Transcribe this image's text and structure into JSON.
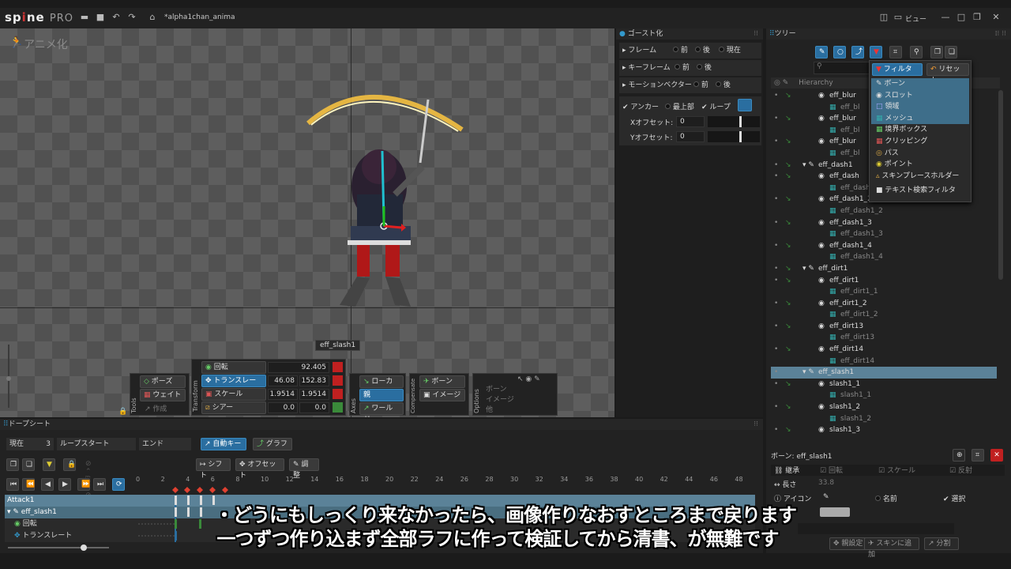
{
  "title_bar": {
    "logo": "sp",
    "logo_mid": "ne",
    "logo_pro": "PRO",
    "project": "*alpha1chan_anima",
    "view_menu": "ビュー"
  },
  "viewport": {
    "mode_label": "アニメ化",
    "bone_tooltip": "eff_slash1"
  },
  "tools": {
    "section": "Tools",
    "pose": "ポーズ",
    "weight": "ウェイト",
    "create": "作成"
  },
  "transform": {
    "section": "Transform",
    "rotate": {
      "label": "回転",
      "value": "92.405"
    },
    "translate": {
      "label": "トランスレート",
      "x": "46.08",
      "y": "152.83"
    },
    "scale": {
      "label": "スケール",
      "x": "1.9514",
      "y": "1.9514"
    },
    "shear": {
      "label": "シアー",
      "x": "0.0",
      "y": "0.0"
    }
  },
  "axes": {
    "section": "Axes",
    "local": "ローカル",
    "parent": "親",
    "world": "ワールド"
  },
  "compensate": {
    "section": "Compensate",
    "bone": "ボーン",
    "image": "イメージ"
  },
  "options": {
    "section": "Options",
    "bone": "ボーン",
    "image": "イメージ",
    "other": "他"
  },
  "ghosting": {
    "title": "ゴースト化",
    "frames": "フレーム",
    "keyframes": "キーフレーム",
    "motion": "モーションベクター",
    "prev": "前",
    "next": "後",
    "current": "現在",
    "anchor": "アンカー",
    "top": "最上部",
    "loop": "ループ",
    "x_offset": "Xオフセット:",
    "y_offset": "Yオフセット:",
    "x_value": "0",
    "y_value": "0"
  },
  "dopesheet": {
    "title": "ドープシート",
    "current": "現在",
    "current_value": "3",
    "loop_start": "ループスタート",
    "end": "エンド",
    "auto_key": "自動キー",
    "graph": "グラフ",
    "shift": "シフト",
    "offset": "オフセット",
    "adjust": "調整",
    "ticks": [
      "0",
      "2",
      "4",
      "6",
      "8",
      "10",
      "12",
      "14",
      "16",
      "18",
      "20",
      "22",
      "24",
      "26",
      "28",
      "30",
      "32",
      "34",
      "36",
      "38",
      "40",
      "42",
      "44",
      "46",
      "48"
    ],
    "rows": [
      {
        "label": "Attack1"
      },
      {
        "label": "eff_slash1"
      },
      {
        "label": "回転"
      },
      {
        "label": "トランスレート"
      }
    ]
  },
  "tree": {
    "title": "ツリー",
    "hierarchy": "Hierarchy",
    "filter": "フィルター",
    "reset": "リセット",
    "items": [
      {
        "name": "eff_blur",
        "type": "slot",
        "eye": true,
        "key": true
      },
      {
        "name": "eff_bl",
        "type": "attachment",
        "eye": false,
        "key": false
      },
      {
        "name": "eff_blur",
        "type": "slot",
        "eye": true,
        "key": true
      },
      {
        "name": "eff_bl",
        "type": "attachment",
        "eye": false,
        "key": false
      },
      {
        "name": "eff_blur",
        "type": "slot",
        "eye": true,
        "key": true
      },
      {
        "name": "eff_bl",
        "type": "attachment",
        "eye": false,
        "key": false
      },
      {
        "name": "eff_dash1",
        "type": "bone",
        "eye": true,
        "key": true
      },
      {
        "name": "eff_dash",
        "type": "slot",
        "eye": true,
        "key": true
      },
      {
        "name": "eff_dash",
        "type": "attachment",
        "eye": false,
        "key": false
      },
      {
        "name": "eff_dash1_2",
        "type": "slot",
        "eye": true,
        "key": true
      },
      {
        "name": "eff_dash1_2",
        "type": "attachment",
        "eye": false,
        "key": false
      },
      {
        "name": "eff_dash1_3",
        "type": "slot",
        "eye": true,
        "key": true
      },
      {
        "name": "eff_dash1_3",
        "type": "attachment",
        "eye": false,
        "key": false
      },
      {
        "name": "eff_dash1_4",
        "type": "slot",
        "eye": true,
        "key": true
      },
      {
        "name": "eff_dash1_4",
        "type": "attachment",
        "eye": false,
        "key": false
      },
      {
        "name": "eff_dirt1",
        "type": "bone",
        "eye": true,
        "key": true
      },
      {
        "name": "eff_dirt1",
        "type": "slot",
        "eye": true,
        "key": true
      },
      {
        "name": "eff_dirt1_1",
        "type": "attachment",
        "eye": false,
        "key": false
      },
      {
        "name": "eff_dirt1_2",
        "type": "slot",
        "eye": true,
        "key": true
      },
      {
        "name": "eff_dirt1_2",
        "type": "attachment",
        "eye": false,
        "key": false
      },
      {
        "name": "eff_dirt13",
        "type": "slot",
        "eye": true,
        "key": true
      },
      {
        "name": "eff_dirt13",
        "type": "attachment",
        "eye": false,
        "key": false
      },
      {
        "name": "eff_dirt14",
        "type": "slot",
        "eye": true,
        "key": true
      },
      {
        "name": "eff_dirt14",
        "type": "attachment",
        "eye": false,
        "key": false
      },
      {
        "name": "eff_slash1",
        "type": "bone",
        "eye": true,
        "key": false,
        "selected": true
      },
      {
        "name": "slash1_1",
        "type": "slot",
        "eye": true,
        "key": true
      },
      {
        "name": "slash1_1",
        "type": "attachment",
        "eye": false,
        "key": false
      },
      {
        "name": "slash1_2",
        "type": "slot",
        "eye": true,
        "key": true
      },
      {
        "name": "slash1_2",
        "type": "attachment",
        "eye": false,
        "key": false
      },
      {
        "name": "slash1_3",
        "type": "slot",
        "eye": true,
        "key": true
      }
    ],
    "filter_menu": [
      "ボーン",
      "スロット",
      "領域",
      "メッシュ",
      "境界ボックス",
      "クリッピング",
      "パス",
      "ポイント",
      "スキンプレースホルダー",
      "テキスト検索フィルタ"
    ]
  },
  "properties": {
    "title": "ボーン: eff_slash1",
    "inherit": "継承",
    "rotate": "回転",
    "scale": "スケール",
    "reflect": "反射",
    "length": "長さ",
    "length_value": "33.8",
    "icon": "アイコン",
    "name": "名前",
    "select": "選択",
    "set_parent": "親設定",
    "add_to_skin": "スキンに追加",
    "split": "分割"
  },
  "subtitles": {
    "line1": "・どうにもしっくり来なかったら、画像作りなおすところまで戻ります",
    "line2": "一つずつ作り込まず全部ラフに作って検証してから清書、が無難です"
  },
  "colors": {
    "accent": "#2a6ea0",
    "key_red": "#c02020",
    "key_green": "#3a8a3a",
    "selected_row": "#5b8298"
  }
}
